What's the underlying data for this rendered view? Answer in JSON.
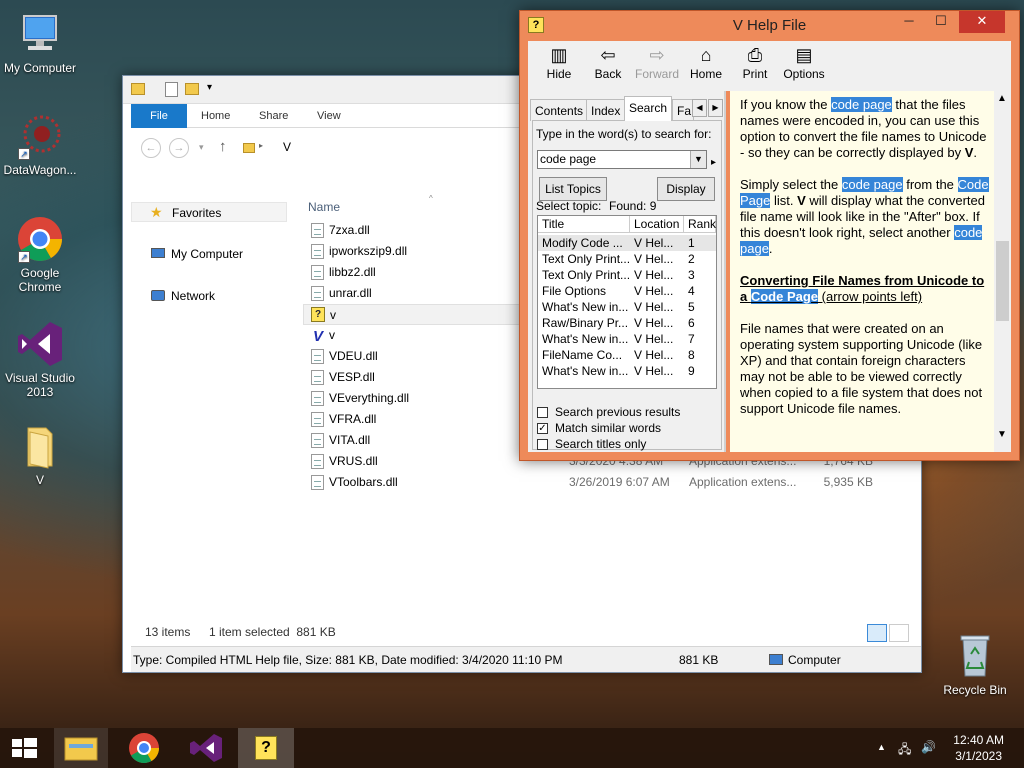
{
  "desktop": {
    "icons": [
      {
        "label": "My Computer"
      },
      {
        "label": "DataWagon..."
      },
      {
        "label": "Google Chrome"
      },
      {
        "label": "Visual Studio 2013"
      },
      {
        "label": "V"
      },
      {
        "label": "Recycle Bin"
      }
    ]
  },
  "explorer": {
    "tabs": [
      "File",
      "Home",
      "Share",
      "View"
    ],
    "address": "V",
    "nav": [
      "Favorites",
      "My Computer",
      "Network"
    ],
    "column_name": "Name",
    "files": [
      {
        "name": "7zxa.dll",
        "date": "",
        "type": "",
        "size": ""
      },
      {
        "name": "ipworkszip9.dll",
        "date": "",
        "type": "",
        "size": ""
      },
      {
        "name": "libbz2.dll",
        "date": "",
        "type": "",
        "size": ""
      },
      {
        "name": "unrar.dll",
        "date": "",
        "type": "",
        "size": ""
      },
      {
        "name": "v",
        "date": "",
        "type": "",
        "size": ""
      },
      {
        "name": "v",
        "date": "",
        "type": "",
        "size": ""
      },
      {
        "name": "VDEU.dll",
        "date": "",
        "type": "",
        "size": ""
      },
      {
        "name": "VESP.dll",
        "date": "",
        "type": "",
        "size": ""
      },
      {
        "name": "VEverything.dll",
        "date": "",
        "type": "",
        "size": ""
      },
      {
        "name": "VFRA.dll",
        "date": "",
        "type": "",
        "size": ""
      },
      {
        "name": "VITA.dll",
        "date": "",
        "type": "",
        "size": ""
      },
      {
        "name": "VRUS.dll",
        "date": "3/3/2020 4:38 AM",
        "type": "Application extens...",
        "size": "1,764 KB"
      },
      {
        "name": "VToolbars.dll",
        "date": "3/26/2019 6:07 AM",
        "type": "Application extens...",
        "size": "5,935 KB"
      }
    ],
    "status_items": "13 items",
    "status_selected": "1 item selected  881 KB",
    "details": "Type: Compiled HTML Help file, Size: 881 KB, Date modified: 3/4/2020 11:10 PM",
    "details_size": "881 KB",
    "details_location": "Computer"
  },
  "help": {
    "title": "V Help File",
    "toolbar": [
      "Hide",
      "Back",
      "Forward",
      "Home",
      "Print",
      "Options"
    ],
    "tabs": [
      "Contents",
      "Index",
      "Search",
      "Fa"
    ],
    "search_prompt": "Type in the word(s) to search for:",
    "search_value": "code page",
    "list_topics": "List Topics",
    "display": "Display",
    "select_topic": "Select topic:",
    "found": "Found: 9",
    "columns": [
      "Title",
      "Location",
      "Rank"
    ],
    "topics": [
      {
        "title": "Modify Code ...",
        "location": "V Hel...",
        "rank": "1"
      },
      {
        "title": "Text Only Print...",
        "location": "V Hel...",
        "rank": "2"
      },
      {
        "title": "Text Only Print...",
        "location": "V Hel...",
        "rank": "3"
      },
      {
        "title": "File Options",
        "location": "V Hel...",
        "rank": "4"
      },
      {
        "title": "What's New in...",
        "location": "V Hel...",
        "rank": "5"
      },
      {
        "title": "Raw/Binary Pr...",
        "location": "V Hel...",
        "rank": "6"
      },
      {
        "title": "What's New in...",
        "location": "V Hel...",
        "rank": "7"
      },
      {
        "title": "FileName Co...",
        "location": "V Hel...",
        "rank": "8"
      },
      {
        "title": "What's New in...",
        "location": "V Hel...",
        "rank": "9"
      }
    ],
    "options": [
      {
        "label": "Search previous results",
        "checked": false
      },
      {
        "label": "Match similar words",
        "checked": true
      },
      {
        "label": "Search titles only",
        "checked": false
      }
    ],
    "content": {
      "p1a": "If you know the ",
      "hl1": "code page",
      "p1b": " that the files names were encoded in, you can use this option to convert the file names to Unicode - so they can be correctly displayed by ",
      "p1v": "V",
      "p1c": ".",
      "p2a": "Simply select the ",
      "hl2": "code page",
      "p2b": " from the ",
      "hl3": "Code Page",
      "p2c": " list. ",
      "p2v": "V",
      "p2d": " will display what the converted file name will look like in the \"After\" box. If this doesn't look right, select another ",
      "hl4": "code page",
      "p2e": ".",
      "h_a": "Converting File Names from Unicode to a ",
      "h_hl": "Code Page",
      "h_b": " (arrow points left)",
      "p3": "File names that were created on an operating system supporting Unicode (like XP) and that contain foreign characters may not be able to be viewed correctly when copied to a file system that does not support Unicode file names."
    }
  },
  "taskbar": {
    "time": "12:40 AM",
    "date": "3/1/2023"
  },
  "colors": {
    "accent": "#1979ca",
    "help_frame": "#ee8a5a",
    "highlight": "#3585d8"
  }
}
